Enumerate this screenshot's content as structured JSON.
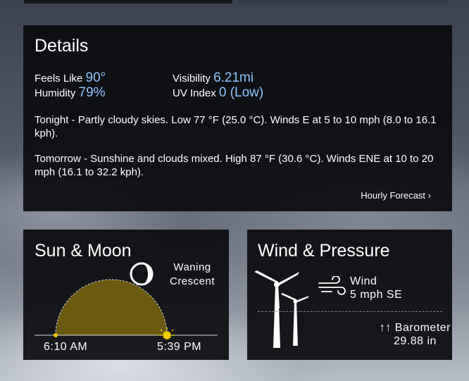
{
  "details": {
    "title": "Details",
    "feels_like_label": "Feels Like",
    "feels_like_value": "90°",
    "humidity_label": "Humidity",
    "humidity_value": "79%",
    "visibility_label": "Visibility",
    "visibility_value": "6.21mi",
    "uv_label": "UV Index",
    "uv_value": "0 (Low)",
    "tonight": "Tonight - Partly cloudy skies. Low 77 °F (25.0 °C). Winds E at 5 to 10 mph (8.0 to 16.1 kph).",
    "tomorrow": "Tomorrow - Sunshine and clouds mixed. High 87 °F (30.6 °C). Winds ENE at 10 to 20 mph (16.1 to 32.2 kph).",
    "hourly_link": "Hourly Forecast ›"
  },
  "sun_moon": {
    "title": "Sun & Moon",
    "moon_phase_line1": "Waning",
    "moon_phase_line2": "Crescent",
    "sunrise": "6:10 AM",
    "sunset": "5:39 PM",
    "sun_color": "#f5d000",
    "arc_fill": "#6b5a10"
  },
  "wind_pressure": {
    "title": "Wind & Pressure",
    "wind_label": "Wind",
    "wind_value": "5 mph SE",
    "barometer_label": "↑↑ Barometer",
    "barometer_value": "29.88 in"
  },
  "icons": [
    "moon-icon",
    "sun-icon",
    "wind-turbine-icon",
    "wind-icon"
  ],
  "colors": {
    "accent_value": "#8ec4ff",
    "card_bg": "#0a0b0e"
  }
}
